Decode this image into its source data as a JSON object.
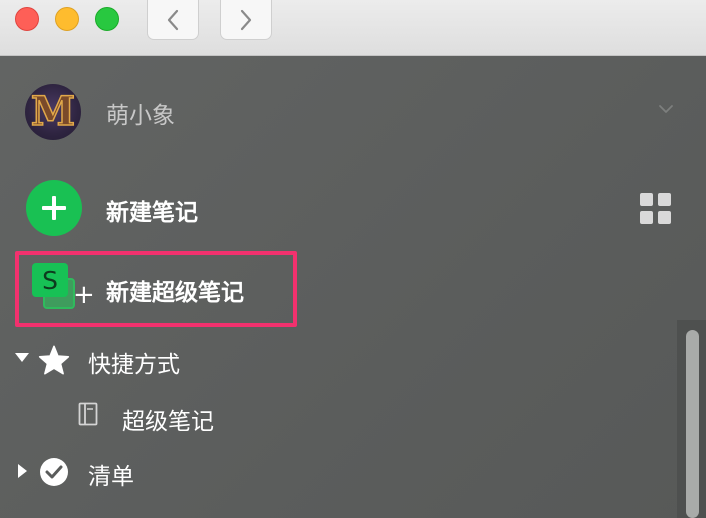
{
  "window": {
    "controls": [
      "close",
      "minimize",
      "zoom"
    ],
    "nav": {
      "back_icon": "chevron-left-icon",
      "forward_icon": "chevron-right-icon"
    }
  },
  "account": {
    "name": "萌小象",
    "avatar_letter": "M",
    "chevron_icon": "chevron-down-icon"
  },
  "actions": {
    "new_note": {
      "label": "新建笔记",
      "icon": "plus-circle-icon",
      "color": "#19c153"
    },
    "new_super_note": {
      "label": "新建超级笔记",
      "icon_letter": "S",
      "plus": "+",
      "highlight_color": "#f2316e"
    },
    "view_toggle_icon": "grid-icon"
  },
  "tree": {
    "shortcuts": {
      "label": "快捷方式",
      "icon": "star-icon",
      "expanded": true
    },
    "shortcut_items": [
      {
        "label": "超级笔记",
        "icon": "document-icon"
      }
    ],
    "list": {
      "label": "清单",
      "icon": "check-circle-icon",
      "expanded": false
    }
  }
}
